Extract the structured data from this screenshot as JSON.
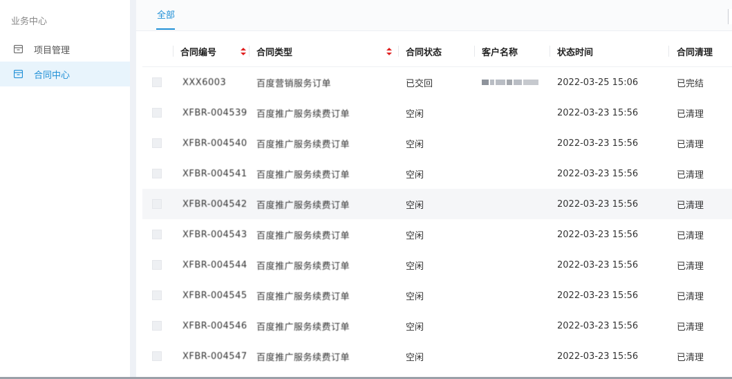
{
  "sidebar": {
    "title": "业务中心",
    "items": [
      {
        "label": "项目管理",
        "icon": "folder-icon",
        "active": false
      },
      {
        "label": "合同中心",
        "icon": "folder-icon",
        "active": true
      }
    ]
  },
  "tabs": [
    {
      "label": "全部",
      "active": true
    }
  ],
  "table": {
    "columns": [
      {
        "key": "contract_no",
        "label": "合同编号",
        "sortable": true
      },
      {
        "key": "contract_type",
        "label": "合同类型",
        "sortable": true
      },
      {
        "key": "contract_status",
        "label": "合同状态",
        "sortable": false
      },
      {
        "key": "customer",
        "label": "客户名称",
        "sortable": false
      },
      {
        "key": "status_time",
        "label": "状态时间",
        "sortable": false
      },
      {
        "key": "clearance",
        "label": "合同清理",
        "sortable": false
      }
    ],
    "rows": [
      {
        "contract_no": "XXX6003",
        "contract_type": "百度营销服务订单",
        "contract_status": "已交回",
        "customer": "",
        "status_time": "2022-03-25 15:06",
        "clearance": "已完结"
      },
      {
        "contract_no": "XFBR-004539",
        "contract_type": "百度推广服务续费订单",
        "contract_status": "空闲",
        "customer": "",
        "status_time": "2022-03-23 15:56",
        "clearance": "已清理"
      },
      {
        "contract_no": "XFBR-004540",
        "contract_type": "百度推广服务续费订单",
        "contract_status": "空闲",
        "customer": "",
        "status_time": "2022-03-23 15:56",
        "clearance": "已清理"
      },
      {
        "contract_no": "XFBR-004541",
        "contract_type": "百度推广服务续费订单",
        "contract_status": "空闲",
        "customer": "",
        "status_time": "2022-03-23 15:56",
        "clearance": "已清理"
      },
      {
        "contract_no": "XFBR-004542",
        "contract_type": "百度推广服务续费订单",
        "contract_status": "空闲",
        "customer": "",
        "status_time": "2022-03-23 15:56",
        "clearance": "已清理"
      },
      {
        "contract_no": "XFBR-004543",
        "contract_type": "百度推广服务续费订单",
        "contract_status": "空闲",
        "customer": "",
        "status_time": "2022-03-23 15:56",
        "clearance": "已清理"
      },
      {
        "contract_no": "XFBR-004544",
        "contract_type": "百度推广服务续费订单",
        "contract_status": "空闲",
        "customer": "",
        "status_time": "2022-03-23 15:56",
        "clearance": "已清理"
      },
      {
        "contract_no": "XFBR-004545",
        "contract_type": "百度推广服务续费订单",
        "contract_status": "空闲",
        "customer": "",
        "status_time": "2022-03-23 15:56",
        "clearance": "已清理"
      },
      {
        "contract_no": "XFBR-004546",
        "contract_type": "百度推广服务续费订单",
        "contract_status": "空闲",
        "customer": "",
        "status_time": "2022-03-23 15:56",
        "clearance": "已清理"
      },
      {
        "contract_no": "XFBR-004547",
        "contract_type": "百度推广服务续费订单",
        "contract_status": "空闲",
        "customer": "",
        "status_time": "2022-03-23 15:56",
        "clearance": "已清理"
      }
    ]
  },
  "colors": {
    "accent": "#1f8fd6",
    "sort_arrow": "#e02020",
    "active_bg": "#e8f4fc"
  }
}
